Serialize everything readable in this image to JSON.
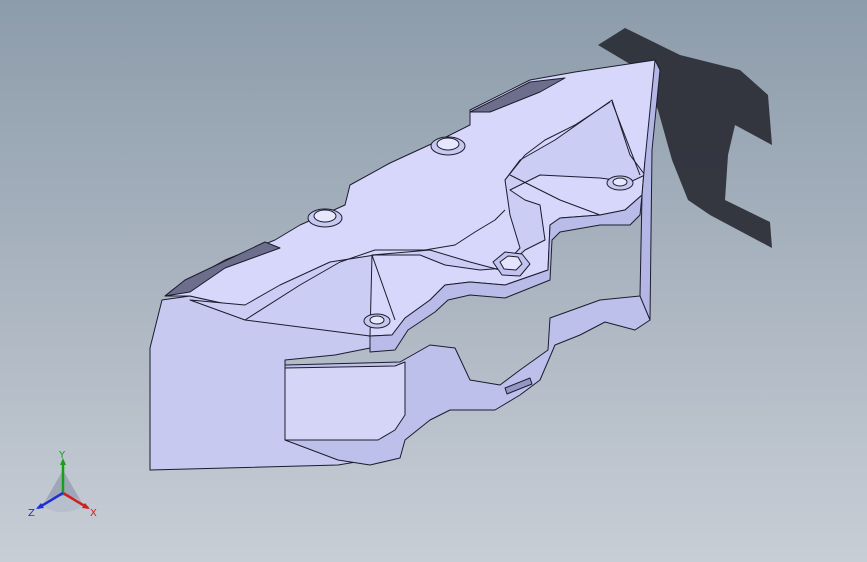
{
  "viewport": {
    "background_top": "#8d9cab",
    "background_bottom": "#c8ced6"
  },
  "model": {
    "face_color": "#c9cbf2",
    "face_light": "#dfe0fb",
    "face_dark": "#aeb0de",
    "edge_color": "#1c1c2e",
    "shadow_color": "#2a2d35"
  },
  "triad": {
    "x_label": "X",
    "y_label": "Y",
    "z_label": "Z",
    "x_color": "#d02020",
    "y_color": "#18a018",
    "z_color": "#2030d0"
  }
}
